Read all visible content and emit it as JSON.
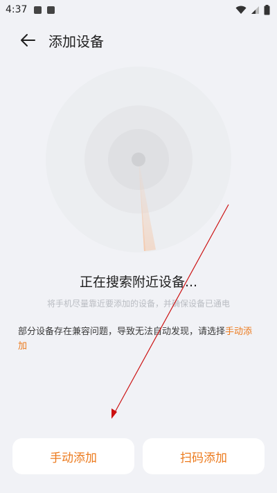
{
  "status_bar": {
    "time": "4:37"
  },
  "header": {
    "title": "添加设备"
  },
  "search": {
    "title": "正在搜索附近设备...",
    "hint": "将手机尽量靠近要添加的设备，并确保设备已通电"
  },
  "note": {
    "text": "部分设备存在兼容问题，导致无法自动发现，请选择",
    "link": "手动添加"
  },
  "buttons": {
    "manual_add": "手动添加",
    "scan_add": "扫码添加"
  },
  "colors": {
    "accent": "#ec7a1d",
    "background": "#f1f2f6",
    "annotation": "#cc1111"
  }
}
